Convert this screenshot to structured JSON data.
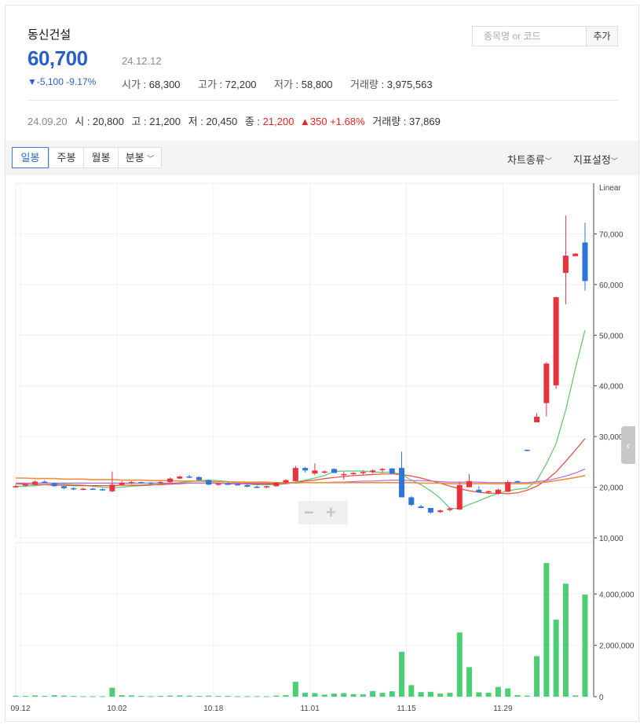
{
  "stock": {
    "name": "동신건설",
    "price": "60,700",
    "date": "24.12.12",
    "change": "▼-5,100 -9.17%",
    "open_label": "시가",
    "open": "68,300",
    "high_label": "고가",
    "high": "72,200",
    "low_label": "저가",
    "low": "58,800",
    "volume_label": "거래량",
    "volume": "3,975,563"
  },
  "search": {
    "placeholder": "종목명 or 코드",
    "add_label": "추가"
  },
  "history": {
    "date": "24.09.20",
    "o_label": "시",
    "o": "20,800",
    "h_label": "고",
    "h": "21,200",
    "l_label": "저",
    "l": "20,450",
    "c_label": "종",
    "c": "21,200",
    "chg": "▲350 +1.68%",
    "v_label": "거래량",
    "v": "37,869"
  },
  "toolbar": {
    "tabs": [
      "일봉",
      "주봉",
      "월봉",
      "분봉"
    ],
    "chart_type": "차트종류",
    "indicator": "지표설정"
  },
  "colors": {
    "up": "#e8323c",
    "down": "#2d75d9",
    "volume": "#4ccf74",
    "ma5": "#5cc86a",
    "ma20": "#e64a3c",
    "ma60": "#b06ae0",
    "ma120": "#f0903a"
  },
  "chart_data": {
    "type": "candlestick",
    "scale_label": "Linear",
    "x_ticks": [
      "09.12",
      "10.02",
      "10.18",
      "11.01",
      "11.15",
      "11.29"
    ],
    "price_ticks": [
      "70,000",
      "60,000",
      "50,000",
      "40,000",
      "30,000",
      "20,000",
      "10,000"
    ],
    "price_range": [
      10000,
      80000
    ],
    "volume_ticks": [
      "4,000,000",
      "2,000,000",
      "0"
    ],
    "volume_range": [
      0,
      6000000
    ],
    "candles": [
      [
        20100,
        20500,
        19900,
        20200,
        40000
      ],
      [
        20300,
        20700,
        20100,
        20600,
        30000
      ],
      [
        20600,
        21300,
        20500,
        21100,
        50000
      ],
      [
        21100,
        21400,
        20800,
        20900,
        30000
      ],
      [
        20800,
        20900,
        20100,
        20200,
        60000
      ],
      [
        20200,
        20300,
        19600,
        19800,
        40000
      ],
      [
        19800,
        20000,
        19400,
        19600,
        30000
      ],
      [
        19600,
        19900,
        19400,
        19700,
        20000
      ],
      [
        19700,
        19900,
        19500,
        19600,
        20000
      ],
      [
        19600,
        19800,
        19300,
        19500,
        20000
      ],
      [
        19200,
        23100,
        19000,
        20500,
        350000
      ],
      [
        20500,
        21200,
        20200,
        20900,
        60000
      ],
      [
        20900,
        21200,
        20600,
        21000,
        50000
      ],
      [
        21000,
        21100,
        20700,
        20900,
        30000
      ],
      [
        20900,
        21000,
        20600,
        20800,
        20000
      ],
      [
        20800,
        21200,
        20700,
        21000,
        30000
      ],
      [
        21000,
        21900,
        20900,
        21700,
        40000
      ],
      [
        21700,
        22300,
        21600,
        22100,
        50000
      ],
      [
        22100,
        22400,
        21800,
        22000,
        40000
      ],
      [
        22000,
        22100,
        21300,
        21400,
        30000
      ],
      [
        21400,
        21500,
        20400,
        20500,
        40000
      ],
      [
        20500,
        20800,
        20300,
        20700,
        30000
      ],
      [
        20700,
        21000,
        20500,
        20600,
        30000
      ],
      [
        20600,
        20800,
        20300,
        20400,
        20000
      ],
      [
        20400,
        20600,
        20000,
        20100,
        20000
      ],
      [
        20100,
        20300,
        19800,
        20000,
        20000
      ],
      [
        20000,
        20300,
        19800,
        20200,
        20000
      ],
      [
        20200,
        21000,
        20100,
        20900,
        40000
      ],
      [
        20900,
        21600,
        20800,
        21400,
        60000
      ],
      [
        21200,
        24200,
        21100,
        23800,
        580000
      ],
      [
        23800,
        24000,
        22900,
        23300,
        150000
      ],
      [
        22700,
        24700,
        22400,
        23300,
        140000
      ],
      [
        22900,
        23300,
        22700,
        23100,
        80000
      ],
      [
        23600,
        23700,
        22800,
        22800,
        120000
      ],
      [
        22500,
        23100,
        21500,
        22600,
        140000
      ],
      [
        22600,
        23000,
        22400,
        22800,
        100000
      ],
      [
        22800,
        23300,
        22500,
        23000,
        90000
      ],
      [
        23000,
        23500,
        22700,
        23300,
        220000
      ],
      [
        23400,
        23800,
        22900,
        23600,
        150000
      ],
      [
        23700,
        23800,
        22900,
        22700,
        210000
      ],
      [
        23800,
        27000,
        18500,
        18000,
        1750000
      ],
      [
        18000,
        18200,
        16300,
        16500,
        450000
      ],
      [
        16200,
        16500,
        15800,
        15900,
        180000
      ],
      [
        15900,
        15900,
        14800,
        15000,
        190000
      ],
      [
        15100,
        15600,
        14900,
        15400,
        120000
      ],
      [
        15500,
        16000,
        15200,
        15800,
        150000
      ],
      [
        15600,
        21100,
        15500,
        20400,
        2500000
      ],
      [
        20000,
        22600,
        20000,
        21200,
        1150000
      ],
      [
        19500,
        20200,
        18900,
        19000,
        170000
      ],
      [
        19000,
        19400,
        18700,
        19200,
        150000
      ],
      [
        18700,
        19700,
        18500,
        19500,
        380000
      ],
      [
        19100,
        21400,
        19000,
        21000,
        320000
      ],
      [
        21200,
        21300,
        20900,
        21000,
        60000
      ],
      [
        27400,
        27400,
        27100,
        27200,
        40000
      ],
      [
        32800,
        34600,
        32800,
        33900,
        1580000
      ],
      [
        36600,
        44700,
        34000,
        44400,
        5200000
      ],
      [
        40100,
        57600,
        39400,
        57500,
        3000000
      ],
      [
        62300,
        73600,
        56100,
        65700,
        4400000
      ],
      [
        65600,
        66200,
        65800,
        66100,
        50000
      ],
      [
        68300,
        72200,
        58800,
        60700,
        3975563
      ]
    ],
    "moving_averages": [
      {
        "name": "ma5",
        "values": [
          20200,
          20200,
          20300,
          20500,
          20600,
          20600,
          20500,
          20400,
          20200,
          20000,
          19900,
          20000,
          20200,
          20300,
          20400,
          20600,
          20700,
          20900,
          21100,
          21300,
          21400,
          21300,
          21100,
          20900,
          20600,
          20500,
          20500,
          20500,
          20700,
          21000,
          21400,
          21800,
          22300,
          23100,
          23200,
          23200,
          23200,
          23000,
          22900,
          23000,
          22500,
          21400,
          20500,
          19300,
          17800,
          15800,
          15800,
          16600,
          17300,
          18100,
          18800,
          19300,
          19600,
          19800,
          21300,
          24600,
          28600,
          35200,
          43400,
          51000
        ]
      },
      {
        "name": "ma20",
        "values": [
          20700,
          20600,
          20500,
          20500,
          20400,
          20400,
          20300,
          20300,
          20300,
          20300,
          20300,
          20400,
          20400,
          20400,
          20500,
          20500,
          20600,
          20700,
          20800,
          20800,
          20800,
          20800,
          20700,
          20700,
          20700,
          20600,
          20600,
          20700,
          20700,
          20900,
          21200,
          21400,
          21700,
          21900,
          22100,
          22300,
          22400,
          22500,
          22600,
          22600,
          22500,
          22200,
          21800,
          21300,
          20800,
          20200,
          19700,
          19300,
          19000,
          18800,
          18800,
          18700,
          18900,
          19400,
          20200,
          21400,
          23000,
          25100,
          27300,
          29600
        ]
      },
      {
        "name": "ma60",
        "values": [
          20800,
          20800,
          20800,
          20800,
          20800,
          20800,
          20800,
          20800,
          20800,
          20800,
          20800,
          20800,
          20800,
          20800,
          20800,
          20800,
          20800,
          20800,
          20800,
          20800,
          20800,
          20800,
          20800,
          20800,
          20800,
          20800,
          20800,
          20800,
          20800,
          20800,
          20900,
          20900,
          20900,
          21000,
          21000,
          21100,
          21200,
          21200,
          21300,
          21400,
          21400,
          21300,
          21300,
          21200,
          21100,
          21000,
          21000,
          21000,
          21000,
          20900,
          20900,
          20900,
          20900,
          20900,
          21100,
          21300,
          21700,
          22200,
          22800,
          23600
        ]
      },
      {
        "name": "ma120",
        "values": [
          21800,
          21800,
          21700,
          21700,
          21700,
          21600,
          21600,
          21600,
          21500,
          21500,
          21500,
          21400,
          21400,
          21400,
          21300,
          21300,
          21300,
          21200,
          21200,
          21200,
          21100,
          21100,
          21100,
          21000,
          21000,
          21000,
          21000,
          20900,
          20900,
          20900,
          20900,
          20900,
          20900,
          20900,
          20900,
          20900,
          20900,
          20900,
          20900,
          20900,
          20900,
          20900,
          20800,
          20800,
          20800,
          20700,
          20700,
          20700,
          20700,
          20700,
          20700,
          20700,
          20700,
          20700,
          20800,
          21000,
          21300,
          21600,
          21900,
          22300
        ]
      }
    ]
  }
}
